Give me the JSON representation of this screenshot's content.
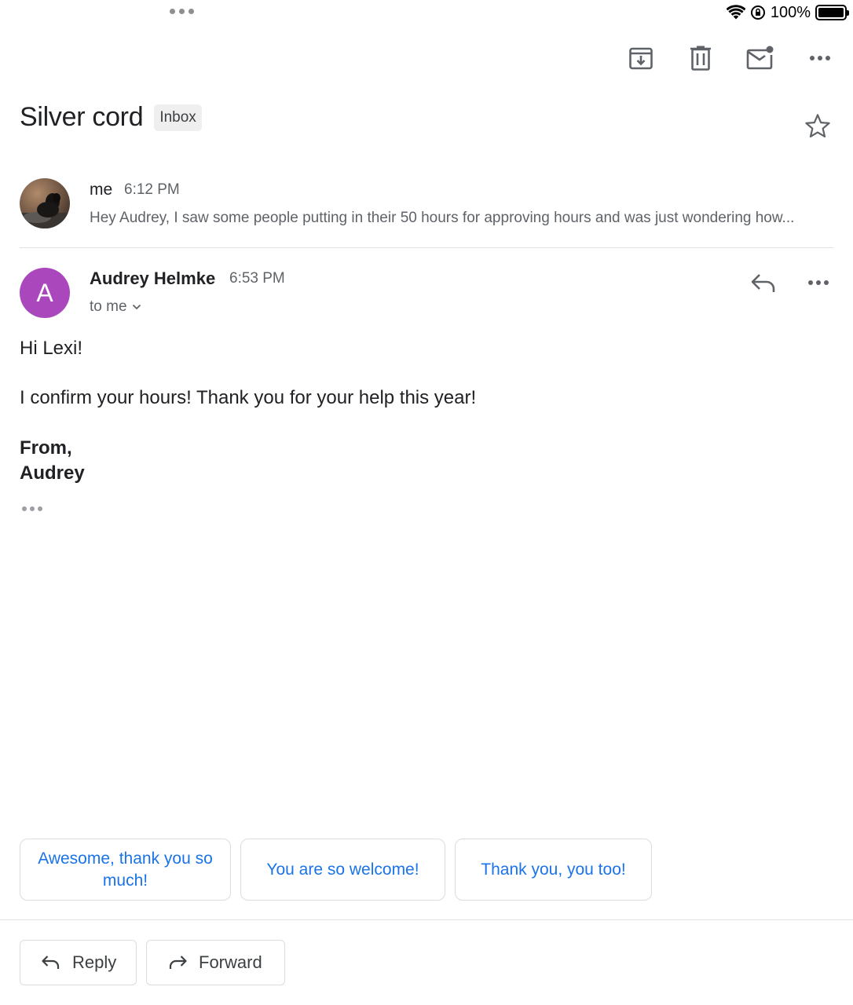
{
  "status_bar": {
    "battery_percent": "100%",
    "battery_level": 1.0
  },
  "toolbar": {
    "icons": [
      "archive-icon",
      "trash-icon",
      "mark-unread-icon",
      "more-icon"
    ]
  },
  "thread": {
    "subject": "Silver cord",
    "label": "Inbox",
    "starred": false
  },
  "collapsed_message": {
    "sender": "me",
    "time": "6:12 PM",
    "snippet": "Hey Audrey, I saw some people putting in their 50 hours for approving hours and was just wondering how..."
  },
  "expanded_message": {
    "avatar_letter": "A",
    "avatar_color": "#ab47bc",
    "sender": "Audrey Helmke",
    "time": "6:53 PM",
    "recipient": "to me",
    "body": {
      "greeting": "Hi Lexi!",
      "line1": "I confirm your hours! Thank you for your help this year!",
      "signoff": "From,",
      "signature": "Audrey"
    }
  },
  "smart_replies": [
    "Awesome, thank you so much!",
    "You are so welcome!",
    "Thank you, you too!"
  ],
  "actions": {
    "reply": "Reply",
    "forward": "Forward"
  },
  "colors": {
    "accent": "#1a73e8",
    "text_secondary": "#5f6368"
  }
}
